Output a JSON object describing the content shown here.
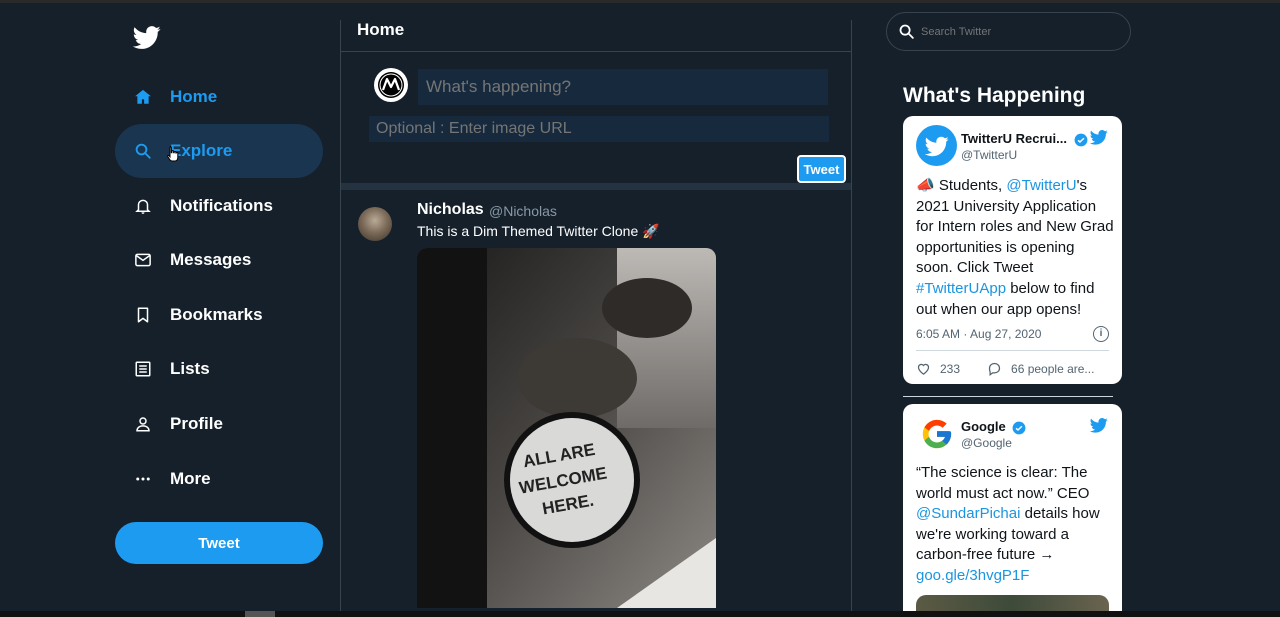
{
  "sidebar": {
    "items": [
      {
        "label": "Home",
        "icon": "home-icon"
      },
      {
        "label": "Explore",
        "icon": "search-icon"
      },
      {
        "label": "Notifications",
        "icon": "bell-icon"
      },
      {
        "label": "Messages",
        "icon": "mail-icon"
      },
      {
        "label": "Bookmarks",
        "icon": "bookmark-icon"
      },
      {
        "label": "Lists",
        "icon": "list-icon"
      },
      {
        "label": "Profile",
        "icon": "person-icon"
      },
      {
        "label": "More",
        "icon": "more-icon"
      }
    ],
    "tweet_button": "Tweet"
  },
  "main": {
    "title": "Home",
    "composer": {
      "what_placeholder": "What's happening?",
      "url_placeholder": "Optional : Enter image URL",
      "tweet_button": "Tweet"
    },
    "tweet": {
      "name": "Nicholas",
      "handle": "@Nicholas",
      "text": "This is a Dim Themed Twitter Clone 🚀",
      "image_text": [
        "ALL ARE",
        "WELCOME",
        "HERE."
      ]
    }
  },
  "right": {
    "search_placeholder": "Search Twitter",
    "title": "What's Happening",
    "cards": [
      {
        "name": "TwitterU Recrui...",
        "handle": "@TwitterU",
        "body_pre": "📣 Students, ",
        "mention": "@TwitterU",
        "body_mid": "'s 2021 University Application for Intern roles and New Grad opportunities is opening soon. Click Tweet ",
        "hashtag": "#TwitterUApp",
        "body_post": " below to find out when our app opens!",
        "time": "6:05 AM · Aug 27, 2020",
        "likes": "233",
        "replies": "66 people are..."
      },
      {
        "name": "Google",
        "handle": "@Google",
        "body_pre": "“The science is clear: The world must act now.” CEO ",
        "mention": "@SundarPichai",
        "body_post": " details how we're working toward a carbon-free future → ",
        "link": "goo.gle/3hvgP1F"
      }
    ]
  },
  "colors": {
    "background": "#15202b",
    "accent": "#1d9bf0",
    "border": "#38444d"
  }
}
